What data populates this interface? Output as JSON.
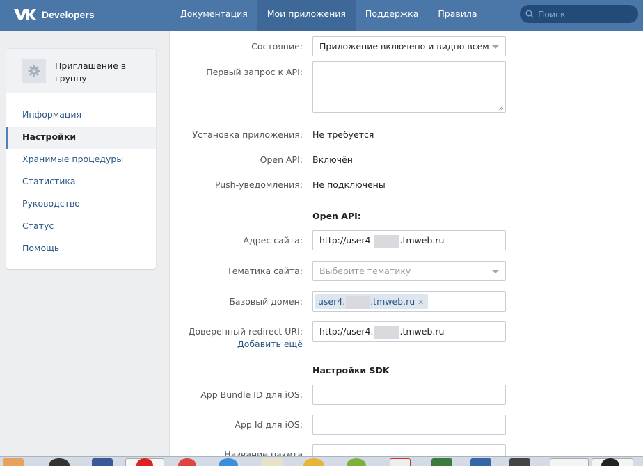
{
  "header": {
    "logo_text": "Developers",
    "nav": [
      {
        "label": "Документация",
        "active": false
      },
      {
        "label": "Мои приложения",
        "active": true
      },
      {
        "label": "Поддержка",
        "active": false
      },
      {
        "label": "Правила",
        "active": false
      }
    ],
    "search_placeholder": "Поиск"
  },
  "sidebar": {
    "app_name": "Приглашение в группу",
    "app_icon": "gear-icon",
    "items": [
      {
        "label": "Информация",
        "active": false
      },
      {
        "label": "Настройки",
        "active": true
      },
      {
        "label": "Хранимые процедуры",
        "active": false
      },
      {
        "label": "Статистика",
        "active": false
      },
      {
        "label": "Руководство",
        "active": false
      },
      {
        "label": "Статус",
        "active": false
      },
      {
        "label": "Помощь",
        "active": false
      }
    ]
  },
  "form": {
    "state_label": "Состояние:",
    "state_value": "Приложение включено и видно всем",
    "first_api_label": "Первый запрос к API:",
    "first_api_value": "",
    "install_label": "Установка приложения:",
    "install_value": "Не требуется",
    "openapi_label": "Open API:",
    "openapi_value": "Включён",
    "push_label": "Push-уведомления:",
    "push_value": "Не подключены",
    "openapi_section": "Open API:",
    "site_label": "Адрес сайта:",
    "site_prefix": "http://user4.",
    "site_suffix": ".tmweb.ru",
    "topic_label": "Тематика сайта:",
    "topic_placeholder": "Выберите тематику",
    "domain_label": "Базовый домен:",
    "domain_prefix": "user4.",
    "domain_suffix": ".tmweb.ru",
    "redirect_label": "Доверенный redirect URI:",
    "redirect_add": "Добавить ещё",
    "redirect_prefix": "http://user4.",
    "redirect_suffix": ".tmweb.ru",
    "sdk_section": "Настройки SDK",
    "bundle_label": "App Bundle ID для iOS:",
    "appid_label": "App Id для iOS:",
    "package_label": "Название пакета"
  },
  "colors": {
    "header_bg": "#4a76a8",
    "link": "#2a5885"
  }
}
